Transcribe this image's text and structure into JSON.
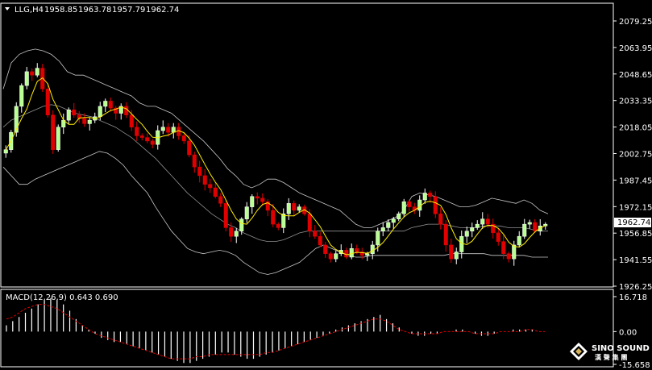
{
  "chart_data": [
    {
      "type": "candlestick",
      "symbol": "LLG,H4",
      "ohlc": {
        "open": "1958.85",
        "high": "1963.78",
        "low": "1957.79",
        "close": "1962.74"
      },
      "current_price": "1962.74",
      "y_ticks": [
        "2079.25",
        "2063.95",
        "2048.65",
        "2033.35",
        "2018.05",
        "2002.75",
        "1987.45",
        "1972.15",
        "1956.85",
        "1941.55",
        "1926.25"
      ],
      "ylim": [
        1926.25,
        2079.25
      ],
      "price_path": [
        2005,
        2015,
        2030,
        2042,
        2050,
        2048,
        2052,
        2040,
        2025,
        2005,
        2018,
        2022,
        2028,
        2025,
        2023,
        2020,
        2022,
        2024,
        2030,
        2033,
        2029,
        2026,
        2030,
        2025,
        2018,
        2013,
        2012,
        2010,
        2008,
        2016,
        2018,
        2015,
        2018,
        2013,
        2010,
        2002,
        1995,
        1990,
        1985,
        1983,
        1978,
        1974,
        1960,
        1955,
        1958,
        1965,
        1972,
        1978,
        1977,
        1975,
        1970,
        1962,
        1960,
        1968,
        1974,
        1970,
        1972,
        1968,
        1958,
        1955,
        1950,
        1945,
        1942,
        1945,
        1947,
        1943,
        1948,
        1946,
        1944,
        1945,
        1950,
        1958,
        1960,
        1963,
        1965,
        1968,
        1975,
        1972,
        1970,
        1976,
        1980,
        1978,
        1968,
        1962,
        1950,
        1942,
        1946,
        1955,
        1958,
        1960,
        1962,
        1965,
        1962,
        1957,
        1952,
        1945,
        1942,
        1950,
        1955,
        1962,
        1963,
        1958,
        1961,
        1962
      ],
      "series": [
        {
          "name": "Upper Band",
          "color": "#c8c8c8",
          "values": [
            2040,
            2055,
            2060,
            2062,
            2063,
            2062,
            2060,
            2056,
            2050,
            2048,
            2048,
            2046,
            2044,
            2042,
            2040,
            2038,
            2036,
            2032,
            2030,
            2030,
            2028,
            2026,
            2022,
            2018,
            2014,
            2010,
            2005,
            2000,
            1994,
            1990,
            1985,
            1983,
            1985,
            1988,
            1988,
            1986,
            1983,
            1980,
            1978,
            1976,
            1974,
            1972,
            1970,
            1966,
            1962,
            1960,
            1960,
            1962,
            1964,
            1966,
            1970,
            1978,
            1980,
            1979,
            1978,
            1976,
            1974,
            1972,
            1972,
            1973,
            1975,
            1977,
            1976,
            1975,
            1974,
            1976,
            1974,
            1970,
            1968
          ]
        },
        {
          "name": "Lower Band",
          "color": "#c8c8c8",
          "values": [
            1995,
            1990,
            1985,
            1985,
            1988,
            1990,
            1992,
            1994,
            1996,
            1998,
            2000,
            2002,
            2004,
            2003,
            2000,
            1996,
            1990,
            1985,
            1980,
            1972,
            1965,
            1958,
            1953,
            1948,
            1946,
            1945,
            1946,
            1947,
            1946,
            1944,
            1940,
            1937,
            1934,
            1933,
            1934,
            1936,
            1938,
            1940,
            1944,
            1948,
            1950,
            1948,
            1946,
            1944,
            1943,
            1943,
            1944,
            1944,
            1944,
            1944,
            1944,
            1944,
            1944,
            1944,
            1944,
            1944,
            1945,
            1945,
            1945,
            1945,
            1945,
            1944,
            1944,
            1944,
            1944,
            1944,
            1943,
            1943,
            1943
          ]
        },
        {
          "name": "Middle Band",
          "color": "#909090",
          "values": [
            2018,
            2022,
            2024,
            2026,
            2028,
            2030,
            2031,
            2030,
            2028,
            2026,
            2025,
            2024,
            2022,
            2020,
            2018,
            2015,
            2012,
            2008,
            2004,
            2000,
            1995,
            1990,
            1985,
            1980,
            1976,
            1972,
            1968,
            1965,
            1962,
            1960,
            1957,
            1955,
            1953,
            1952,
            1952,
            1953,
            1955,
            1957,
            1958,
            1958,
            1958,
            1958,
            1958,
            1958,
            1958,
            1958,
            1958,
            1958,
            1958,
            1958,
            1958,
            1960,
            1961,
            1962,
            1962,
            1962,
            1961,
            1960,
            1960,
            1960,
            1961,
            1961,
            1961,
            1960,
            1960,
            1960,
            1959,
            1958,
            1958
          ]
        }
      ]
    },
    {
      "type": "bar",
      "title": "MACD(12,26,9) 0.643 0.690",
      "y_ticks": [
        "16.718",
        "0.00",
        "-15.658"
      ],
      "ylim": [
        -15.658,
        16.718
      ],
      "values": [
        3,
        5,
        7,
        9,
        11,
        13,
        15,
        16,
        15,
        13,
        10,
        6,
        3,
        1,
        -1,
        -3,
        -4,
        -5,
        -5,
        -6,
        -7,
        -8,
        -9,
        -10,
        -11,
        -12,
        -13,
        -14,
        -15,
        -15,
        -14,
        -13,
        -12,
        -11,
        -10,
        -10,
        -11,
        -12,
        -13,
        -13,
        -12,
        -11,
        -10,
        -9,
        -8,
        -7,
        -6,
        -5,
        -4,
        -3,
        -2,
        -1,
        1,
        2,
        3,
        4,
        5,
        6,
        7,
        8,
        6,
        4,
        2,
        0,
        -1,
        -2,
        -2,
        -1,
        -1,
        0,
        0,
        1,
        1,
        0,
        -1,
        -2,
        -2,
        -1,
        0,
        0,
        1,
        1,
        1,
        1,
        0,
        0
      ],
      "signal": [
        6,
        7,
        9,
        11,
        12,
        13,
        13,
        12,
        11,
        9,
        7,
        5,
        3,
        1,
        -1,
        -2,
        -3,
        -4,
        -5,
        -6,
        -7,
        -8,
        -9,
        -10,
        -11,
        -12,
        -13,
        -13,
        -13,
        -13,
        -12,
        -12,
        -11,
        -11,
        -11,
        -11,
        -11,
        -11,
        -11,
        -11,
        -11,
        -10,
        -10,
        -9,
        -8,
        -7,
        -6,
        -5,
        -4,
        -3,
        -2,
        -1,
        0,
        1,
        2,
        3,
        4,
        5,
        6,
        6,
        5,
        3,
        1,
        0,
        -1,
        -1,
        -1,
        -1,
        -1,
        0,
        0,
        0,
        0,
        0,
        -1,
        -1,
        -1,
        -1,
        0,
        0,
        0,
        0,
        1,
        1,
        0,
        0
      ]
    }
  ],
  "logo": {
    "name": "SINO SOUND",
    "subtitle": "漢 聲 集 團"
  },
  "colors": {
    "bull": "#ffffff",
    "bear": "#e00000",
    "bull_body": "#b7ff8f",
    "ma": "#ffee00",
    "grid": "#ffffff",
    "macd_bar": "#ffffff",
    "signal": "#e00000"
  }
}
